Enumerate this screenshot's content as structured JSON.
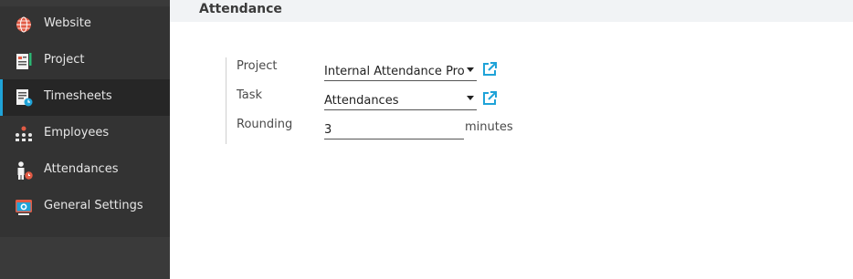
{
  "sidebar": {
    "items": [
      {
        "label": "Website",
        "icon": "globe-icon"
      },
      {
        "label": "Project",
        "icon": "project-icon"
      },
      {
        "label": "Timesheets",
        "icon": "timesheet-icon",
        "active": true
      },
      {
        "label": "Employees",
        "icon": "employees-icon"
      },
      {
        "label": "Attendances",
        "icon": "attendances-icon"
      },
      {
        "label": "General Settings",
        "icon": "general-settings-icon"
      }
    ]
  },
  "header": {
    "title": "Attendance"
  },
  "form": {
    "project": {
      "label": "Project",
      "value": "Internal Attendance Pro"
    },
    "task": {
      "label": "Task",
      "value": "Attendances"
    },
    "rounding": {
      "label": "Rounding",
      "value": "3",
      "unit": "minutes"
    }
  },
  "colors": {
    "accent": "#1fa3d8",
    "sidebar": "#333333",
    "header": "#f1f3f5"
  }
}
